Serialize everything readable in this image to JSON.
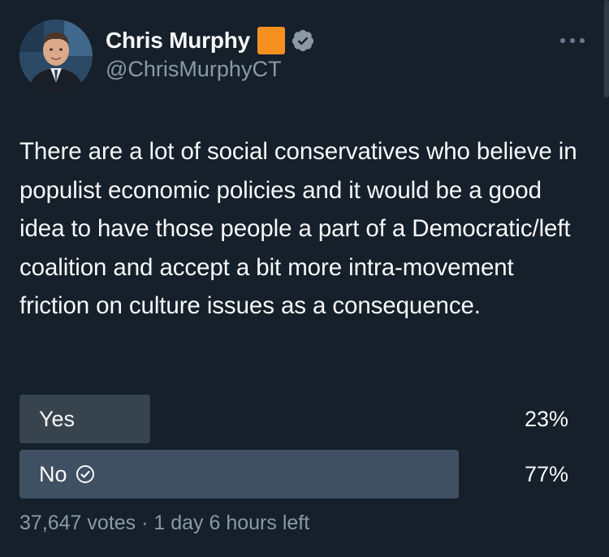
{
  "author": {
    "display_name": "Chris Murphy",
    "handle": "@ChrisMurphyCT",
    "badge_emoji": "orange-square",
    "verified_icon": "verified-badge-icon"
  },
  "tweet": {
    "text": "There are a lot of social conservatives who believe in populist economic policies and it would be a good idea to have those people a part of a Democratic/left coalition and accept a bit more intra-movement friction on culture issues as a consequence."
  },
  "poll": {
    "options": [
      {
        "label": "Yes",
        "percent": "23%",
        "fraction": 0.23,
        "selected": false
      },
      {
        "label": "No",
        "percent": "77%",
        "fraction": 0.77,
        "selected": true
      }
    ],
    "footer": "37,647 votes · 1 day 6 hours left"
  },
  "colors": {
    "background": "#15202b",
    "text": "#f7f9f9",
    "muted": "#8b98a5",
    "bar_default": "#38444d",
    "bar_winner": "#3f5063",
    "orange_square": "#f5901e",
    "verified": "#8b98a5"
  }
}
